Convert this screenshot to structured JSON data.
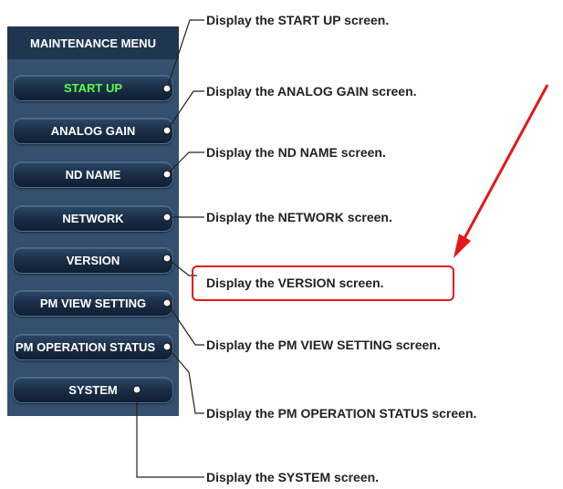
{
  "menu": {
    "title": "MAINTENANCE MENU",
    "items": [
      {
        "label": "START UP",
        "active": true
      },
      {
        "label": "ANALOG GAIN",
        "active": false
      },
      {
        "label": "ND NAME",
        "active": false
      },
      {
        "label": "NETWORK",
        "active": false
      },
      {
        "label": "VERSION",
        "active": false
      },
      {
        "label": "PM VIEW SETTING",
        "active": false
      },
      {
        "label": "PM OPERATION STATUS",
        "active": false
      },
      {
        "label": "SYSTEM",
        "active": false
      }
    ]
  },
  "callouts": [
    "Display the START UP screen.",
    "Display the ANALOG GAIN screen.",
    "Display the ND NAME screen.",
    "Display the NETWORK screen.",
    "Display the VERSION screen.",
    "Display the PM VIEW SETTING screen.",
    "Display the PM OPERATION STATUS screen.",
    "Display the SYSTEM screen."
  ],
  "colors": {
    "panel": "#35506f",
    "header": "#1f3650",
    "active_label": "#5aff4a",
    "highlight": "#e4171b"
  }
}
